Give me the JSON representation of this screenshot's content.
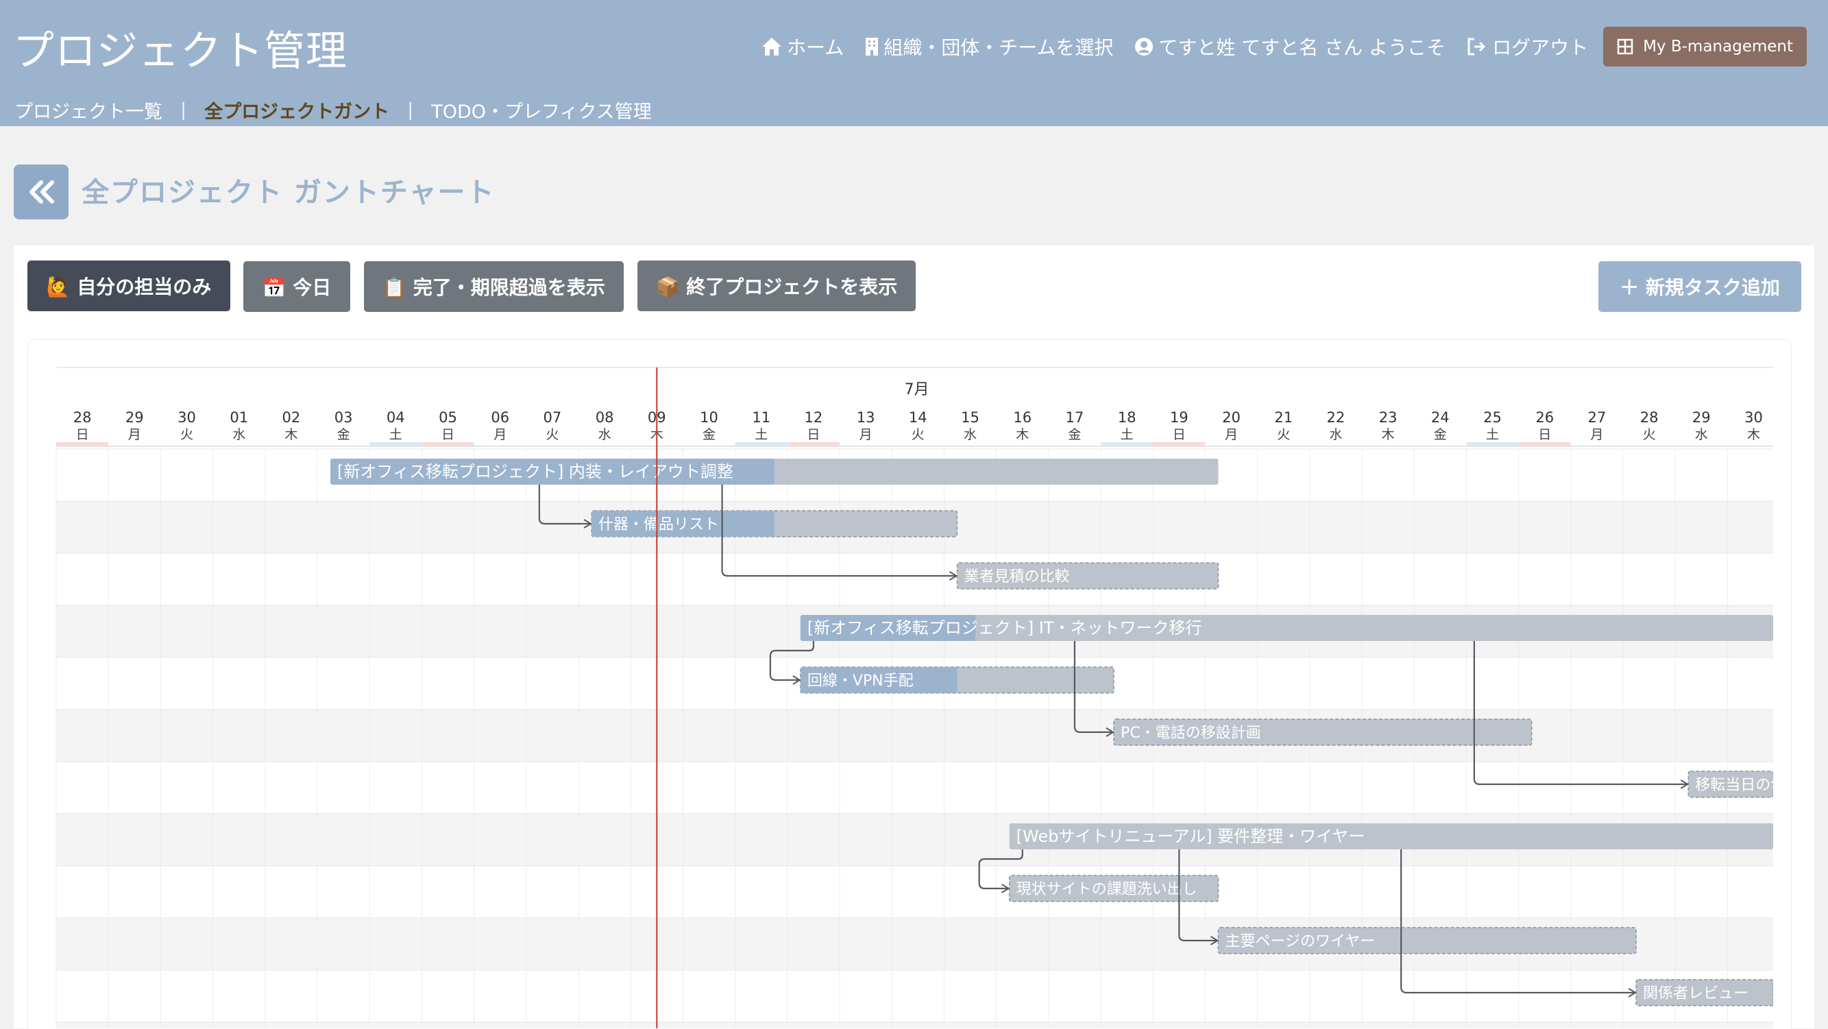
{
  "app": {
    "brand": "プロジェクト管理",
    "nav": {
      "home": "ホーム",
      "org_select": "組織・団体・チームを選択",
      "welcome": "てすと姓 てすと名 さん ようこそ",
      "logout": "ログアウト",
      "my_btn": "My B-management"
    },
    "subnav": {
      "projects": "プロジェクト一覧",
      "gantt": "全プロジェクトガント",
      "todo": "TODO・プレフィクス管理",
      "sep": "|"
    }
  },
  "page": {
    "title": "全プロジェクト ガントチャート"
  },
  "toolbar": {
    "mine": "🙋 自分の担当のみ",
    "today": "📅 今日",
    "show_done": "📋 完了・期限超過を表示",
    "show_closed": "📦 終了プロジェクトを表示",
    "new_task": "＋ 新規タスク追加"
  },
  "gantt": {
    "month_label": "7月",
    "days": [
      {
        "d": "28",
        "w": "日",
        "type": "sun"
      },
      {
        "d": "29",
        "w": "月",
        "type": ""
      },
      {
        "d": "30",
        "w": "火",
        "type": ""
      },
      {
        "d": "01",
        "w": "水",
        "type": ""
      },
      {
        "d": "02",
        "w": "木",
        "type": ""
      },
      {
        "d": "03",
        "w": "金",
        "type": ""
      },
      {
        "d": "04",
        "w": "土",
        "type": "sat"
      },
      {
        "d": "05",
        "w": "日",
        "type": "sun"
      },
      {
        "d": "06",
        "w": "月",
        "type": ""
      },
      {
        "d": "07",
        "w": "火",
        "type": ""
      },
      {
        "d": "08",
        "w": "水",
        "type": ""
      },
      {
        "d": "09",
        "w": "木",
        "type": "today"
      },
      {
        "d": "10",
        "w": "金",
        "type": ""
      },
      {
        "d": "11",
        "w": "土",
        "type": "sat"
      },
      {
        "d": "12",
        "w": "日",
        "type": "sun"
      },
      {
        "d": "13",
        "w": "月",
        "type": ""
      },
      {
        "d": "14",
        "w": "火",
        "type": ""
      },
      {
        "d": "15",
        "w": "水",
        "type": ""
      },
      {
        "d": "16",
        "w": "木",
        "type": ""
      },
      {
        "d": "17",
        "w": "金",
        "type": ""
      },
      {
        "d": "18",
        "w": "土",
        "type": "sat"
      },
      {
        "d": "19",
        "w": "日",
        "type": "sun"
      },
      {
        "d": "20",
        "w": "月",
        "type": ""
      },
      {
        "d": "21",
        "w": "火",
        "type": ""
      },
      {
        "d": "22",
        "w": "水",
        "type": ""
      },
      {
        "d": "23",
        "w": "木",
        "type": ""
      },
      {
        "d": "24",
        "w": "金",
        "type": ""
      },
      {
        "d": "25",
        "w": "土",
        "type": "sat"
      },
      {
        "d": "26",
        "w": "日",
        "type": "sun"
      },
      {
        "d": "27",
        "w": "月",
        "type": ""
      },
      {
        "d": "28",
        "w": "火",
        "type": ""
      },
      {
        "d": "29",
        "w": "水",
        "type": ""
      },
      {
        "d": "30",
        "w": "木",
        "type": ""
      }
    ],
    "tasks": [
      {
        "label": "[新オフィス移転プロジェクト] 内装・レイアウト調整",
        "start": 5.25,
        "end": 22.25,
        "progress": 0.5,
        "kind": "project"
      },
      {
        "label": "什器・備品リスト",
        "start": 10.25,
        "end": 17.25,
        "progress": 0.5,
        "kind": "task"
      },
      {
        "label": "業者見積の比較",
        "start": 17.25,
        "end": 22.25,
        "progress": 0,
        "kind": "task"
      },
      {
        "label": "[新オフィス移転プロジェクト] IT・ネットワーク移行",
        "start": 14.25,
        "end": 33,
        "progress": 0.18,
        "kind": "project"
      },
      {
        "label": "回線・VPN手配",
        "start": 14.25,
        "end": 20.25,
        "progress": 0.5,
        "kind": "task"
      },
      {
        "label": "PC・電話の移設計画",
        "start": 20.25,
        "end": 28.25,
        "progress": 0,
        "kind": "task"
      },
      {
        "label": "移転当日の切替",
        "start": 31.25,
        "end": 33,
        "progress": 0,
        "kind": "task"
      },
      {
        "label": "[Webサイトリニューアル] 要件整理・ワイヤー",
        "start": 18.25,
        "end": 33,
        "progress": 0,
        "kind": "project"
      },
      {
        "label": "現状サイトの課題洗い出し",
        "start": 18.25,
        "end": 22.25,
        "progress": 0,
        "kind": "task"
      },
      {
        "label": "主要ページのワイヤー",
        "start": 22.25,
        "end": 30.25,
        "progress": 0,
        "kind": "task"
      },
      {
        "label": "関係者レビュー",
        "start": 30.25,
        "end": 33,
        "progress": 0,
        "kind": "task"
      }
    ],
    "links": [
      {
        "from": 0,
        "to": 1,
        "x": 9.25
      },
      {
        "from": 0,
        "to": 2,
        "x": 12.75
      },
      {
        "from": 3,
        "to": 4,
        "x": 14.5
      },
      {
        "from": 3,
        "to": 5,
        "x": 19.5
      },
      {
        "from": 3,
        "to": 6,
        "x": 27.15
      },
      {
        "from": 7,
        "to": 8,
        "x": 18.5
      },
      {
        "from": 7,
        "to": 9,
        "x": 21.5
      },
      {
        "from": 7,
        "to": 10,
        "x": 25.75
      }
    ],
    "today_index": 11,
    "colors": {
      "bar": "#bdc3cc",
      "progress": "#9cb3cd",
      "today_line": "#c0392b",
      "sat": "#dde9f7",
      "sun": "#f9dada",
      "link": "#555a60"
    }
  }
}
